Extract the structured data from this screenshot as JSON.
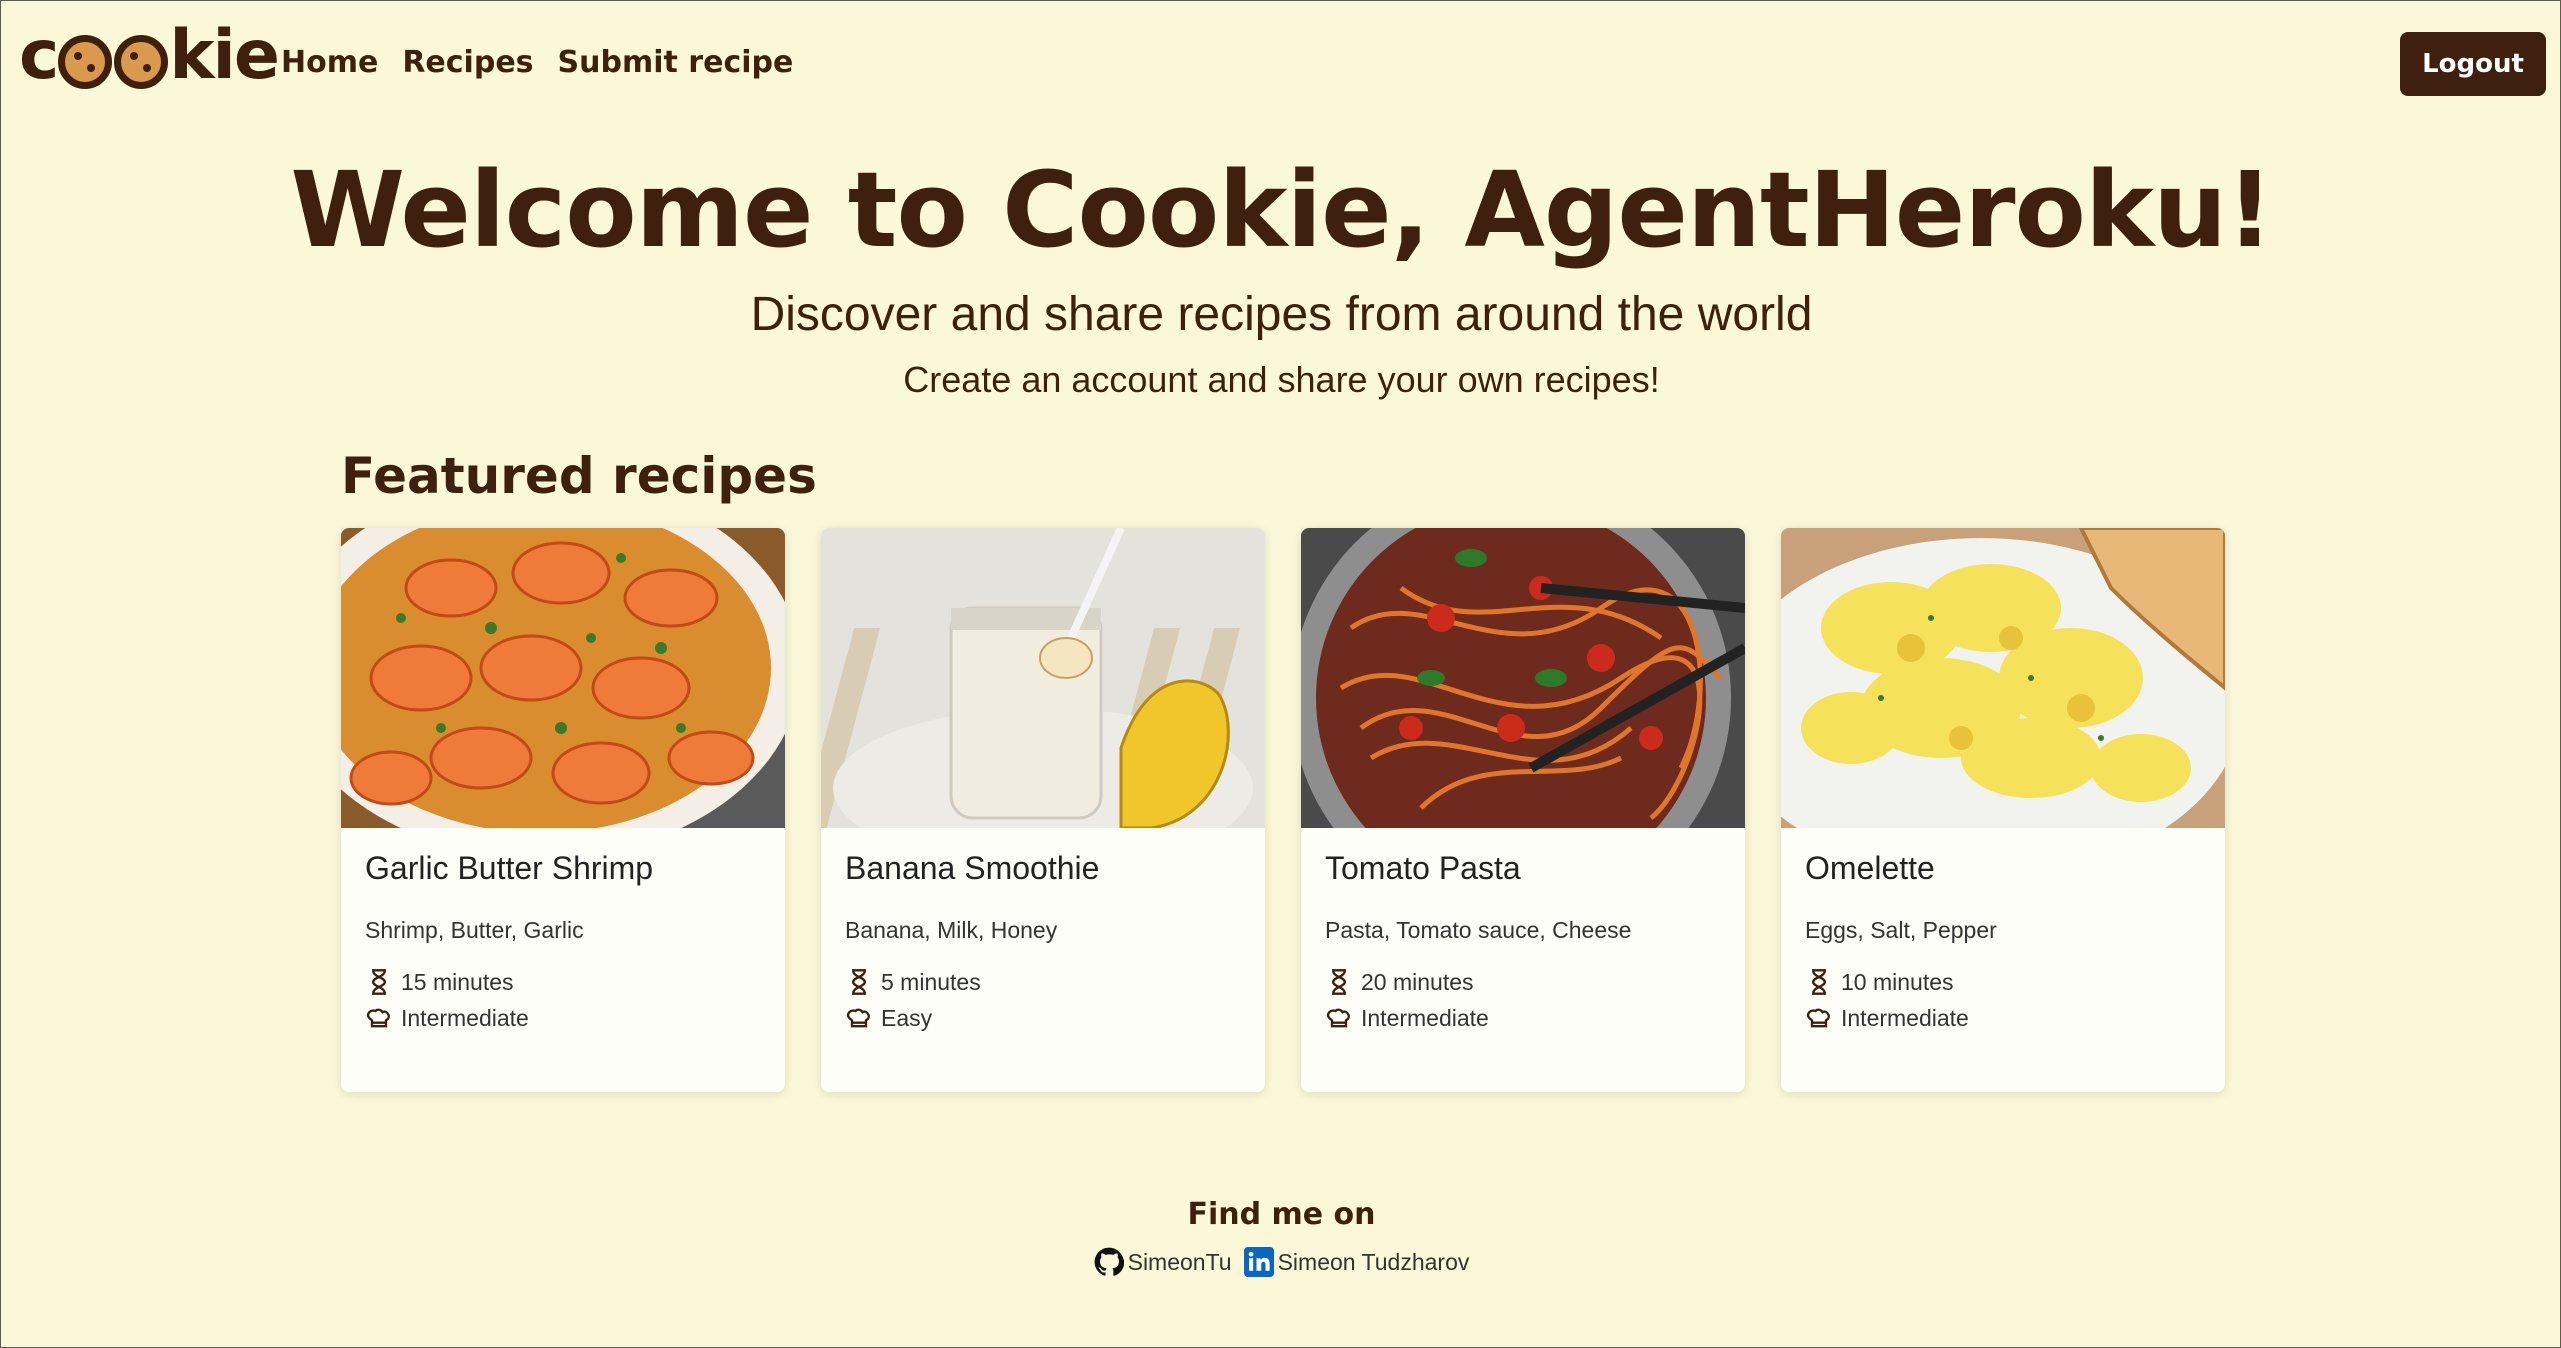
{
  "nav": {
    "logo_text_prefix": "c",
    "logo_text_suffix": "kie",
    "links": [
      "Home",
      "Recipes",
      "Submit recipe"
    ],
    "logout_label": "Logout"
  },
  "hero": {
    "title": "Welcome to Cookie, AgentHeroku!",
    "subtitle": "Discover and share recipes from around the world",
    "subtitle2": "Create an account and share your own recipes!"
  },
  "featured": {
    "title": "Featured recipes",
    "recipes": [
      {
        "name": "Garlic Butter Shrimp",
        "ingredients": "Shrimp, Butter, Garlic",
        "time": "15 minutes",
        "difficulty": "Intermediate"
      },
      {
        "name": "Banana Smoothie",
        "ingredients": "Banana, Milk, Honey",
        "time": "5 minutes",
        "difficulty": "Easy"
      },
      {
        "name": "Tomato Pasta",
        "ingredients": "Pasta, Tomato sauce, Cheese",
        "time": "20 minutes",
        "difficulty": "Intermediate"
      },
      {
        "name": "Omelette",
        "ingredients": "Eggs, Salt, Pepper",
        "time": "10 minutes",
        "difficulty": "Intermediate"
      }
    ]
  },
  "footer": {
    "title": "Find me on",
    "github": "SimeonTu",
    "linkedin": "Simeon Tudzharov"
  },
  "colors": {
    "background": "#faf8d8",
    "brand": "#3f1f0d",
    "linkedin": "#0a66c2"
  }
}
